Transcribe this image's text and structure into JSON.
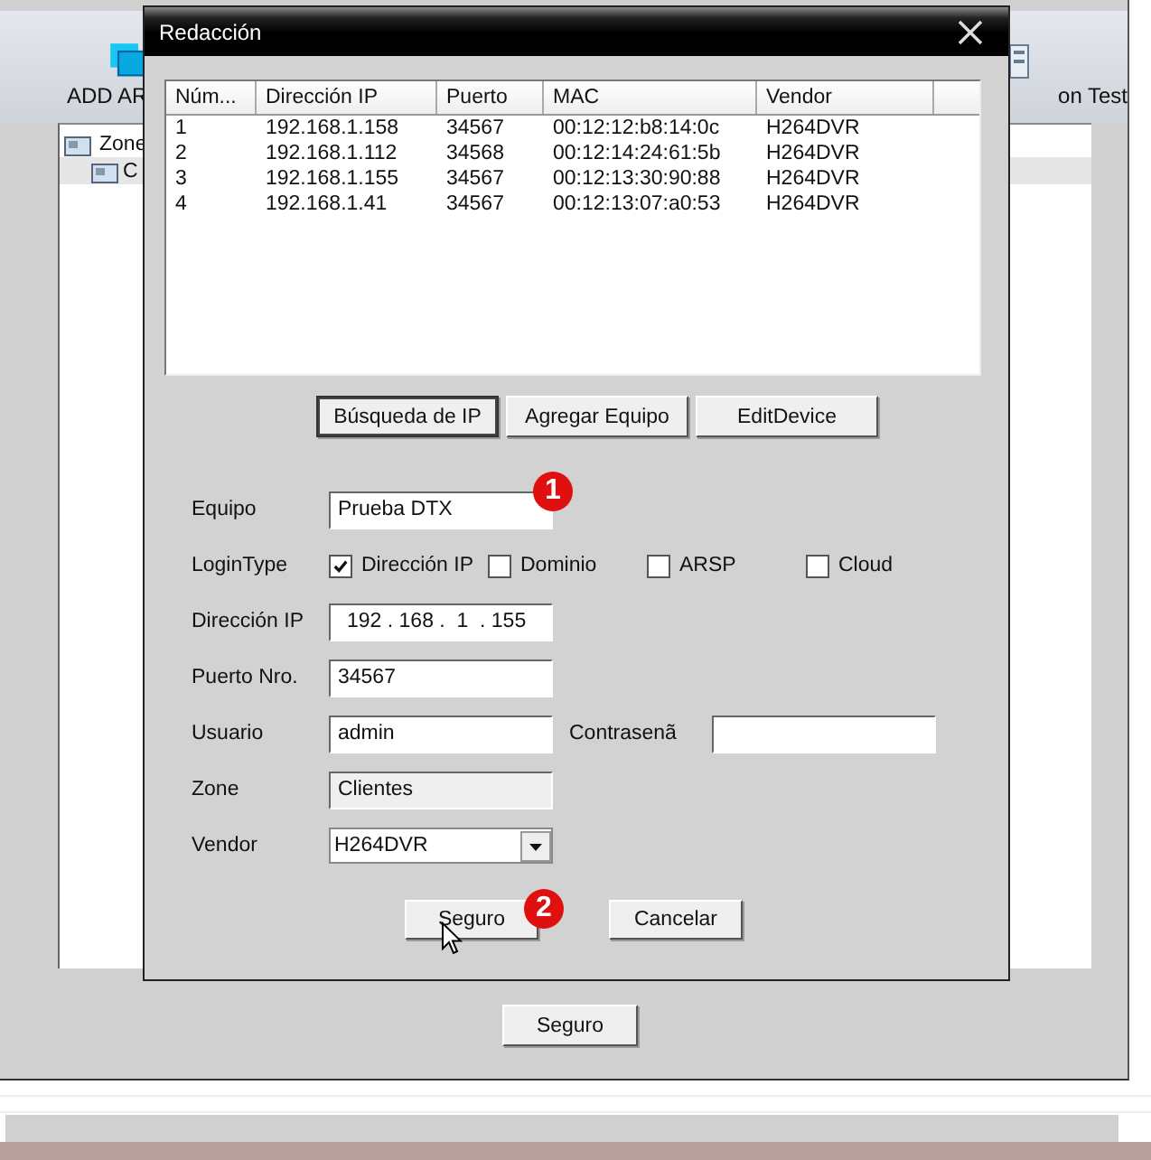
{
  "background_window": {
    "toolbar": [
      {
        "label": "ADD AR"
      },
      {
        "label": "on Test"
      }
    ],
    "tree": {
      "items": [
        {
          "label": "Zone",
          "children": [
            {
              "label": "C",
              "selected": true
            }
          ]
        }
      ]
    },
    "buttons": [
      "Seguro"
    ]
  },
  "dialog": {
    "title": "Redacción",
    "table": {
      "columns": [
        "Núm...",
        "Dirección IP",
        "Puerto",
        "MAC",
        "Vendor"
      ],
      "rows": [
        [
          "1",
          "192.168.1.158",
          "34567",
          "00:12:12:b8:14:0c",
          "H264DVR"
        ],
        [
          "2",
          "192.168.1.112",
          "34568",
          "00:12:14:24:61:5b",
          "H264DVR"
        ],
        [
          "3",
          "192.168.1.155",
          "34567",
          "00:12:13:30:90:88",
          "H264DVR"
        ],
        [
          "4",
          "192.168.1.41",
          "34567",
          "00:12:13:07:a0:53",
          "H264DVR"
        ]
      ]
    },
    "buttons": [
      {
        "label": "Búsqueda de IP",
        "selected": true
      },
      {
        "label": "Agregar Equipo",
        "selected": false
      },
      {
        "label": "EditDevice",
        "selected": false
      }
    ],
    "fields": [
      {
        "kind": "text",
        "label": "Equipo",
        "value": "Prueba DTX",
        "disabled": false,
        "callout": "1"
      },
      {
        "kind": "checks",
        "label": "LoginType",
        "options": [
          {
            "label": "Dirección IP",
            "checked": true
          },
          {
            "label": "Dominio",
            "checked": false
          },
          {
            "label": "ARSP",
            "checked": false
          },
          {
            "label": "Cloud",
            "checked": false
          }
        ]
      },
      {
        "kind": "ip",
        "label": "Dirección IP",
        "value": "192 . 168 .  1  . 155"
      },
      {
        "kind": "text",
        "label": "Puerto Nro.",
        "value": "34567",
        "disabled": false
      },
      {
        "kind": "pair",
        "label": "Usuario",
        "value": "admin",
        "second_label": "Contrasenã"
      },
      {
        "kind": "text",
        "label": "Zone",
        "value": "Clientes",
        "disabled": true
      },
      {
        "kind": "select",
        "label": "Vendor",
        "value": "H264DVR"
      }
    ],
    "footer_buttons": [
      {
        "label": "Seguro",
        "callout": "2"
      },
      {
        "label": "Cancelar"
      }
    ]
  }
}
